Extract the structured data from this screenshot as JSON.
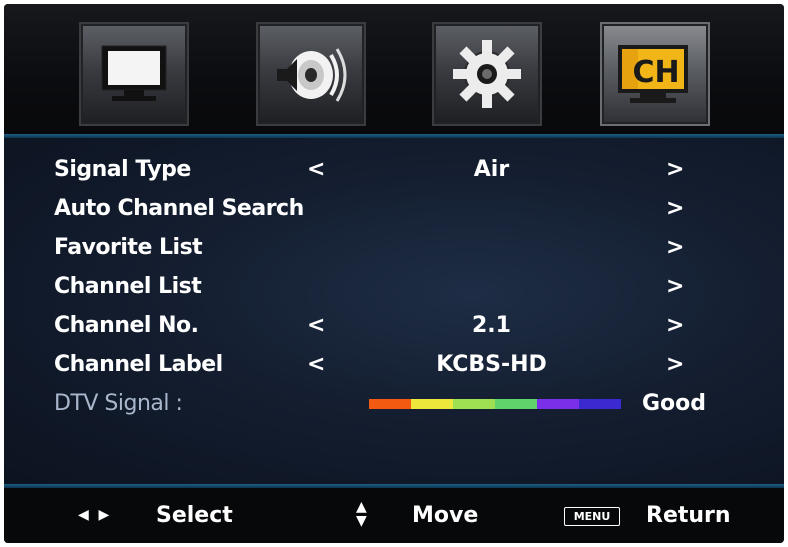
{
  "tabs": [
    {
      "name": "picture",
      "icon": "tv-monitor-icon"
    },
    {
      "name": "sound",
      "icon": "speaker-icon"
    },
    {
      "name": "setup",
      "icon": "gear-icon"
    },
    {
      "name": "channel",
      "icon": "ch-icon",
      "label": "CH",
      "active": true
    }
  ],
  "menu": {
    "rows": [
      {
        "label": "Signal Type",
        "value": "Air"
      },
      {
        "label": "Auto Channel Search"
      },
      {
        "label": "Favorite List"
      },
      {
        "label": "Channel List"
      },
      {
        "label": "Channel No.",
        "value": "2.1"
      },
      {
        "label": "Channel Label",
        "value": "KCBS-HD"
      }
    ],
    "arrow_left": "<",
    "arrow_right": ">",
    "dtv_signal": {
      "label": "DTV Signal :",
      "status": "Good",
      "bar_colors": [
        "#f25a12",
        "#ece73a",
        "#9fe052",
        "#5fd46b",
        "#7a2fe8",
        "#3b2ad0"
      ]
    }
  },
  "footer": {
    "select": {
      "icon": "left-right-arrows-icon",
      "label": "Select"
    },
    "move": {
      "icon": "up-down-arrows-icon",
      "label": "Move"
    },
    "return": {
      "key": "MENU",
      "label": "Return"
    }
  },
  "colors": {
    "accent": "#1d5e86",
    "ch_icon": "#f2b517"
  }
}
